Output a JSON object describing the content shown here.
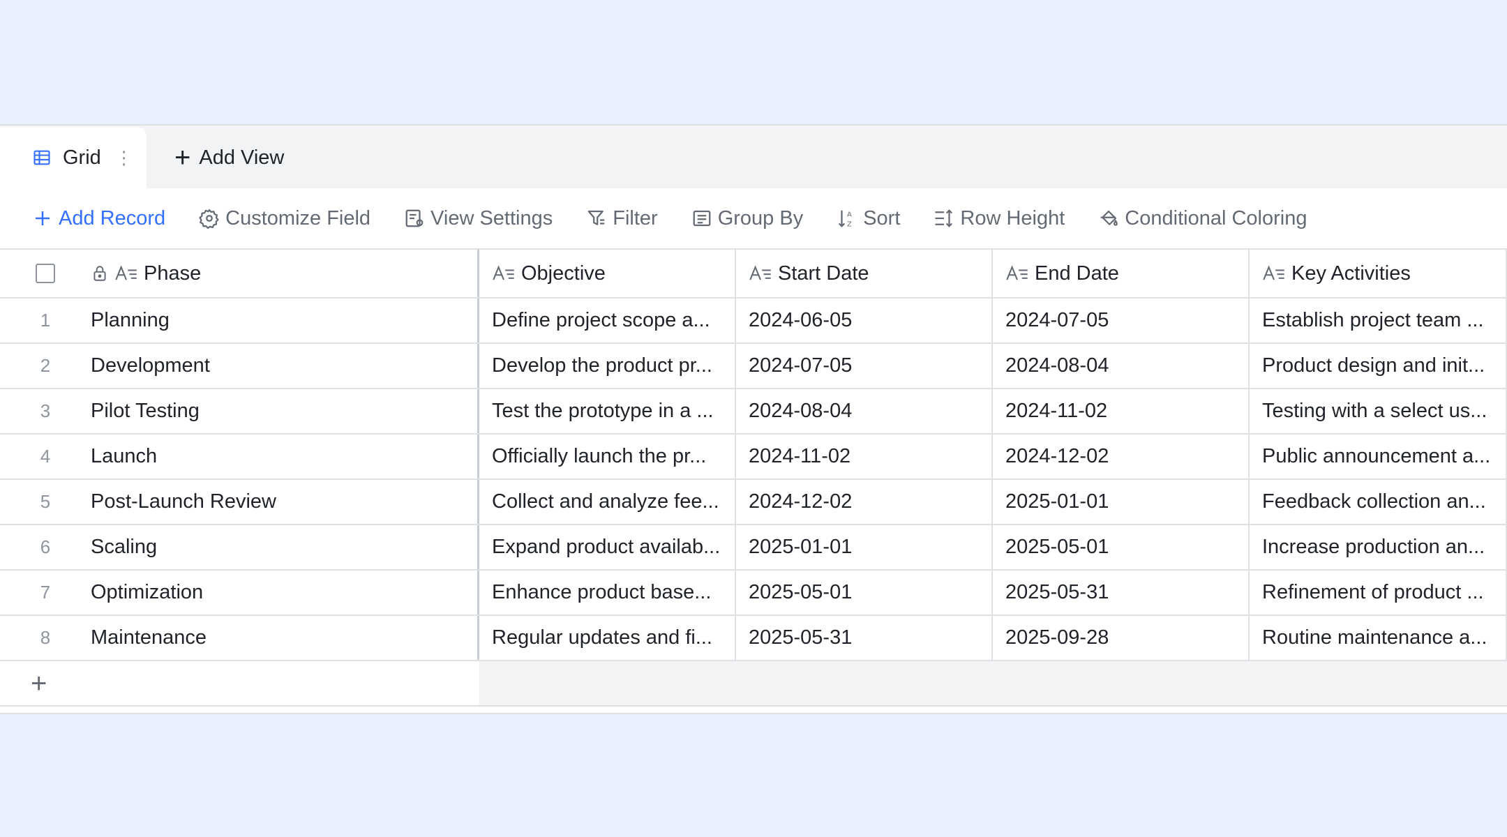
{
  "tabs": {
    "active_label": "Grid",
    "add_view_label": "Add View"
  },
  "toolbar": {
    "add_record": "Add Record",
    "customize_field": "Customize Field",
    "view_settings": "View Settings",
    "filter": "Filter",
    "group_by": "Group By",
    "sort": "Sort",
    "row_height": "Row Height",
    "conditional_coloring": "Conditional Coloring"
  },
  "columns": {
    "phase": "Phase",
    "objective": "Objective",
    "start_date": "Start Date",
    "end_date": "End Date",
    "key_activities": "Key Activities"
  },
  "rows": [
    {
      "n": "1",
      "phase": "Planning",
      "objective": "Define project scope a...",
      "start": "2024-06-05",
      "end": "2024-07-05",
      "key": "Establish project team ..."
    },
    {
      "n": "2",
      "phase": "Development",
      "objective": "Develop the product pr...",
      "start": "2024-07-05",
      "end": "2024-08-04",
      "key": "Product design and init..."
    },
    {
      "n": "3",
      "phase": "Pilot Testing",
      "objective": "Test the prototype in a ...",
      "start": "2024-08-04",
      "end": "2024-11-02",
      "key": "Testing with a select us..."
    },
    {
      "n": "4",
      "phase": "Launch",
      "objective": "Officially launch the pr...",
      "start": "2024-11-02",
      "end": "2024-12-02",
      "key": "Public announcement a..."
    },
    {
      "n": "5",
      "phase": "Post-Launch Review",
      "objective": "Collect and analyze fee...",
      "start": "2024-12-02",
      "end": "2025-01-01",
      "key": "Feedback collection an..."
    },
    {
      "n": "6",
      "phase": "Scaling",
      "objective": "Expand product availab...",
      "start": "2025-01-01",
      "end": "2025-05-01",
      "key": "Increase production an..."
    },
    {
      "n": "7",
      "phase": "Optimization",
      "objective": "Enhance product base...",
      "start": "2025-05-01",
      "end": "2025-05-31",
      "key": "Refinement of product ..."
    },
    {
      "n": "8",
      "phase": "Maintenance",
      "objective": "Regular updates and fi...",
      "start": "2025-05-31",
      "end": "2025-09-28",
      "key": "Routine maintenance a..."
    }
  ],
  "colors": {
    "accent": "#3370ff",
    "background": "#e8effe",
    "border": "#dee0e3"
  }
}
